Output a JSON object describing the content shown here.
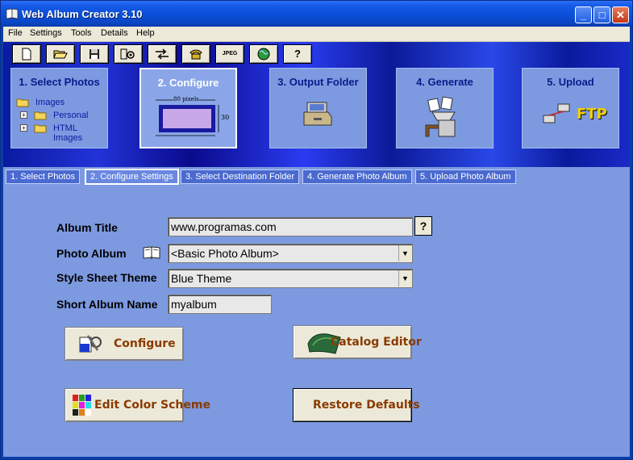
{
  "window": {
    "title": "Web Album Creator 3.10"
  },
  "menu": [
    "File",
    "Settings",
    "Tools",
    "Details",
    "Help"
  ],
  "toolbar": [
    {
      "icon": "new-file-icon",
      "glyph": "🗋"
    },
    {
      "icon": "open-folder-icon",
      "glyph": "📂"
    },
    {
      "icon": "save-disk-icon",
      "glyph": "💾"
    },
    {
      "icon": "image-settings-icon",
      "glyph": "⚙"
    },
    {
      "icon": "transfer-arrows-icon",
      "glyph": "⇄"
    },
    {
      "icon": "phone-icon",
      "glyph": "☎"
    },
    {
      "icon": "jpeg-icon",
      "glyph": "JPEG"
    },
    {
      "icon": "globe-icon",
      "glyph": "●"
    },
    {
      "icon": "help-icon",
      "glyph": "?"
    }
  ],
  "steps": [
    {
      "label": "1. Select Photos",
      "active": false
    },
    {
      "label": "2. Configure",
      "active": true
    },
    {
      "label": "3. Output Folder",
      "active": false
    },
    {
      "label": "4. Generate",
      "active": false
    },
    {
      "label": "5. Upload",
      "active": false
    }
  ],
  "tree": [
    "Images",
    "Personal",
    "HTML Images"
  ],
  "configure_diagram": {
    "width_label": "80 pixels",
    "height_label": "30"
  },
  "upload_label": "FTP",
  "tabs": [
    {
      "label": "1. Select Photos",
      "active": false
    },
    {
      "label": "2. Configure Settings",
      "active": true
    },
    {
      "label": "3. Select Destination Folder",
      "active": false
    },
    {
      "label": "4. Generate Photo Album",
      "active": false
    },
    {
      "label": "5. Upload Photo Album",
      "active": false
    }
  ],
  "form": {
    "album_title_label": "Album Title",
    "album_title_value": "www.programas.com",
    "photo_album_label": "Photo Album",
    "photo_album_value": "<Basic Photo Album>",
    "style_sheet_label": "Style Sheet Theme",
    "style_sheet_value": "Blue Theme",
    "short_name_label": "Short Album Name",
    "short_name_value": "myalbum",
    "help_glyph": "?"
  },
  "buttons": {
    "configure": "Configure",
    "catalog_editor": "Catalog Editor",
    "edit_color_scheme": "Edit Color Scheme",
    "restore_defaults": "Restore Defaults"
  },
  "colors": {
    "accent": "#0a4fd8",
    "panel": "#7d9ae0",
    "button_text": "#8a3a00"
  }
}
